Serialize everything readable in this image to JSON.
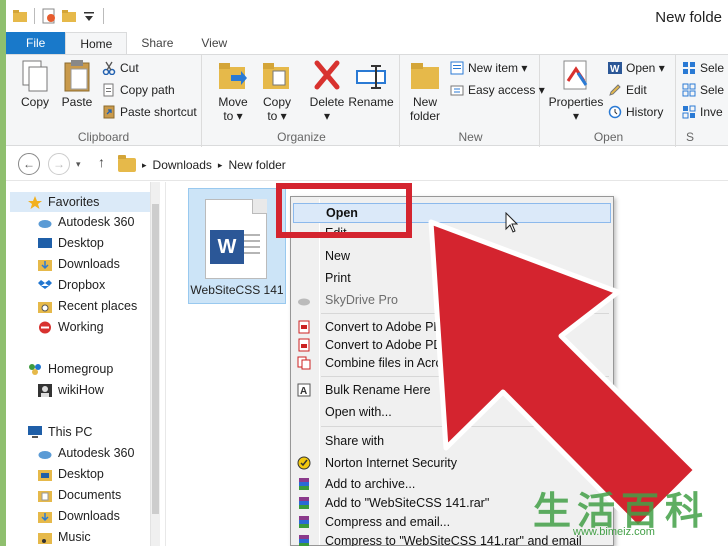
{
  "window": {
    "title": "New folde"
  },
  "ribbon_tabs": [
    {
      "label": "File"
    },
    {
      "label": "Home"
    },
    {
      "label": "Share"
    },
    {
      "label": "View"
    }
  ],
  "ribbon": {
    "clipboard": {
      "label": "Clipboard",
      "copy": "Copy",
      "paste": "Paste",
      "cut": "Cut",
      "copy_path": "Copy path",
      "paste_shortcut": "Paste shortcut"
    },
    "organize": {
      "label": "Organize",
      "move_to": "Move",
      "move_to2": "to ▾",
      "copy_to": "Copy",
      "copy_to2": "to ▾",
      "delete": "Delete",
      "delete2": "▾",
      "rename": "Rename"
    },
    "new": {
      "label": "New",
      "new_folder": "New",
      "new_folder2": "folder",
      "new_item": "New item ▾",
      "easy_access": "Easy access ▾"
    },
    "open": {
      "label": "Open",
      "properties": "Properties",
      "properties2": "▾",
      "open": "Open ▾",
      "edit": "Edit",
      "history": "History"
    },
    "select": {
      "label": "S",
      "select_all": "Sele",
      "select_none": "Sele",
      "invert": "Inve"
    }
  },
  "address": {
    "back": "←",
    "forward": "→",
    "up": "↑",
    "crumbs": [
      "Downloads",
      "New folder"
    ],
    "sep": "▸"
  },
  "nav": {
    "favorites": "Favorites",
    "autodesk": "Autodesk 360",
    "desktop": "Desktop",
    "downloads": "Downloads",
    "dropbox": "Dropbox",
    "recent": "Recent places",
    "working": "Working",
    "homegroup": "Homegroup",
    "wikihow": "wikiHow",
    "thispc": "This PC",
    "pc_autodesk": "Autodesk 360",
    "pc_desktop": "Desktop",
    "pc_documents": "Documents",
    "pc_downloads": "Downloads",
    "pc_music": "Music"
  },
  "file": {
    "name": "WebSiteCSS 141",
    "badge": "W"
  },
  "context_menu": {
    "open": "Open",
    "edit": "Edit",
    "new": "New",
    "print": "Print",
    "skydrive": "SkyDrive Pro",
    "convert_pdf": "Convert to Adobe PDF",
    "convert_email": "Convert to Adobe PDF and EMail",
    "combine": "Combine files in Acrobat...",
    "bulk_rename": "Bulk Rename Here",
    "open_with": "Open with...",
    "share_with": "Share with",
    "norton": "Norton Internet Security",
    "add_archive": "Add to archive...",
    "add_rar": "Add to \"WebSiteCSS 141.rar\"",
    "compress_email": "Compress and email...",
    "compress_rar_email": "Compress to \"WebSiteCSS 141.rar\" and email",
    "submenu_arrow": "▶"
  },
  "watermark": {
    "chars": "生活百科",
    "url": "www.bimeiz.com"
  },
  "colors": {
    "annotation_red": "#d4242f",
    "file_tab": "#1979ca",
    "selection": "#cce4f7"
  }
}
